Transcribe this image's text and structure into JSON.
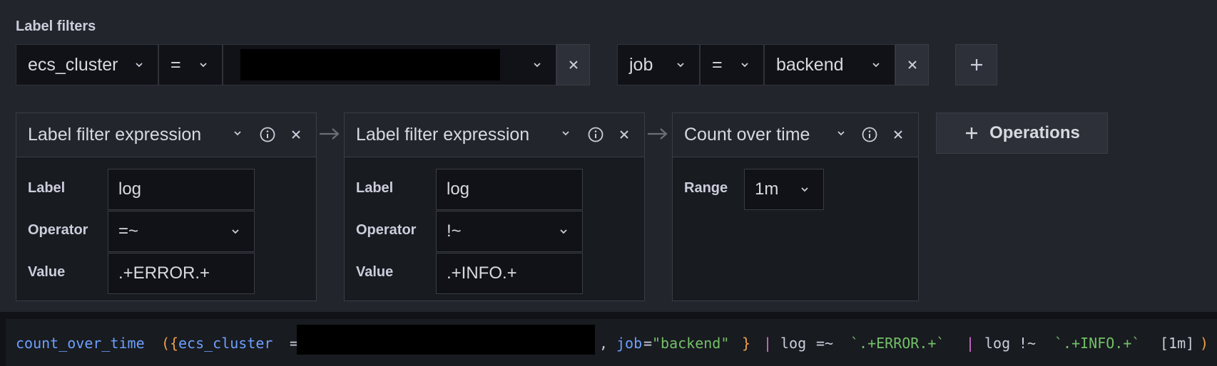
{
  "section_title": "Label filters",
  "filters": [
    {
      "label": "ecs_cluster",
      "operator": "=",
      "value": ""
    },
    {
      "label": "job",
      "operator": "=",
      "value": "backend"
    }
  ],
  "operations": [
    {
      "title": "Label filter expression",
      "rows": [
        {
          "label": "Label",
          "value": "log"
        },
        {
          "label": "Operator",
          "value": "=~"
        },
        {
          "label": "Value",
          "value": ".+ERROR.+"
        }
      ]
    },
    {
      "title": "Label filter expression",
      "rows": [
        {
          "label": "Label",
          "value": "log"
        },
        {
          "label": "Operator",
          "value": "!~"
        },
        {
          "label": "Value",
          "value": ".+INFO.+"
        }
      ]
    },
    {
      "title": "Count over time",
      "rows": [
        {
          "label": "Range",
          "value": "1m"
        }
      ]
    }
  ],
  "ops_button": "Operations",
  "query": {
    "fn": "count_over_time",
    "open_paren": "(",
    "open_brace": "{",
    "label1": "ecs_cluster",
    "eq": "=",
    "comma": ",",
    "label2": "job",
    "value2": "\"backend\"",
    "close_brace": "}",
    "pipe": "|",
    "log": "log",
    "op1": "=~",
    "val1": "`.+ERROR.+`",
    "op2": "!~",
    "val2": "`.+INFO.+`",
    "range": "[1m]",
    "close_paren": ")"
  },
  "colors": {
    "background": "#22252b",
    "query_function": "#6e9fff",
    "query_string": "#73bf69",
    "query_pipe": "#d86fd8",
    "query_brace": "#f0a04b"
  }
}
